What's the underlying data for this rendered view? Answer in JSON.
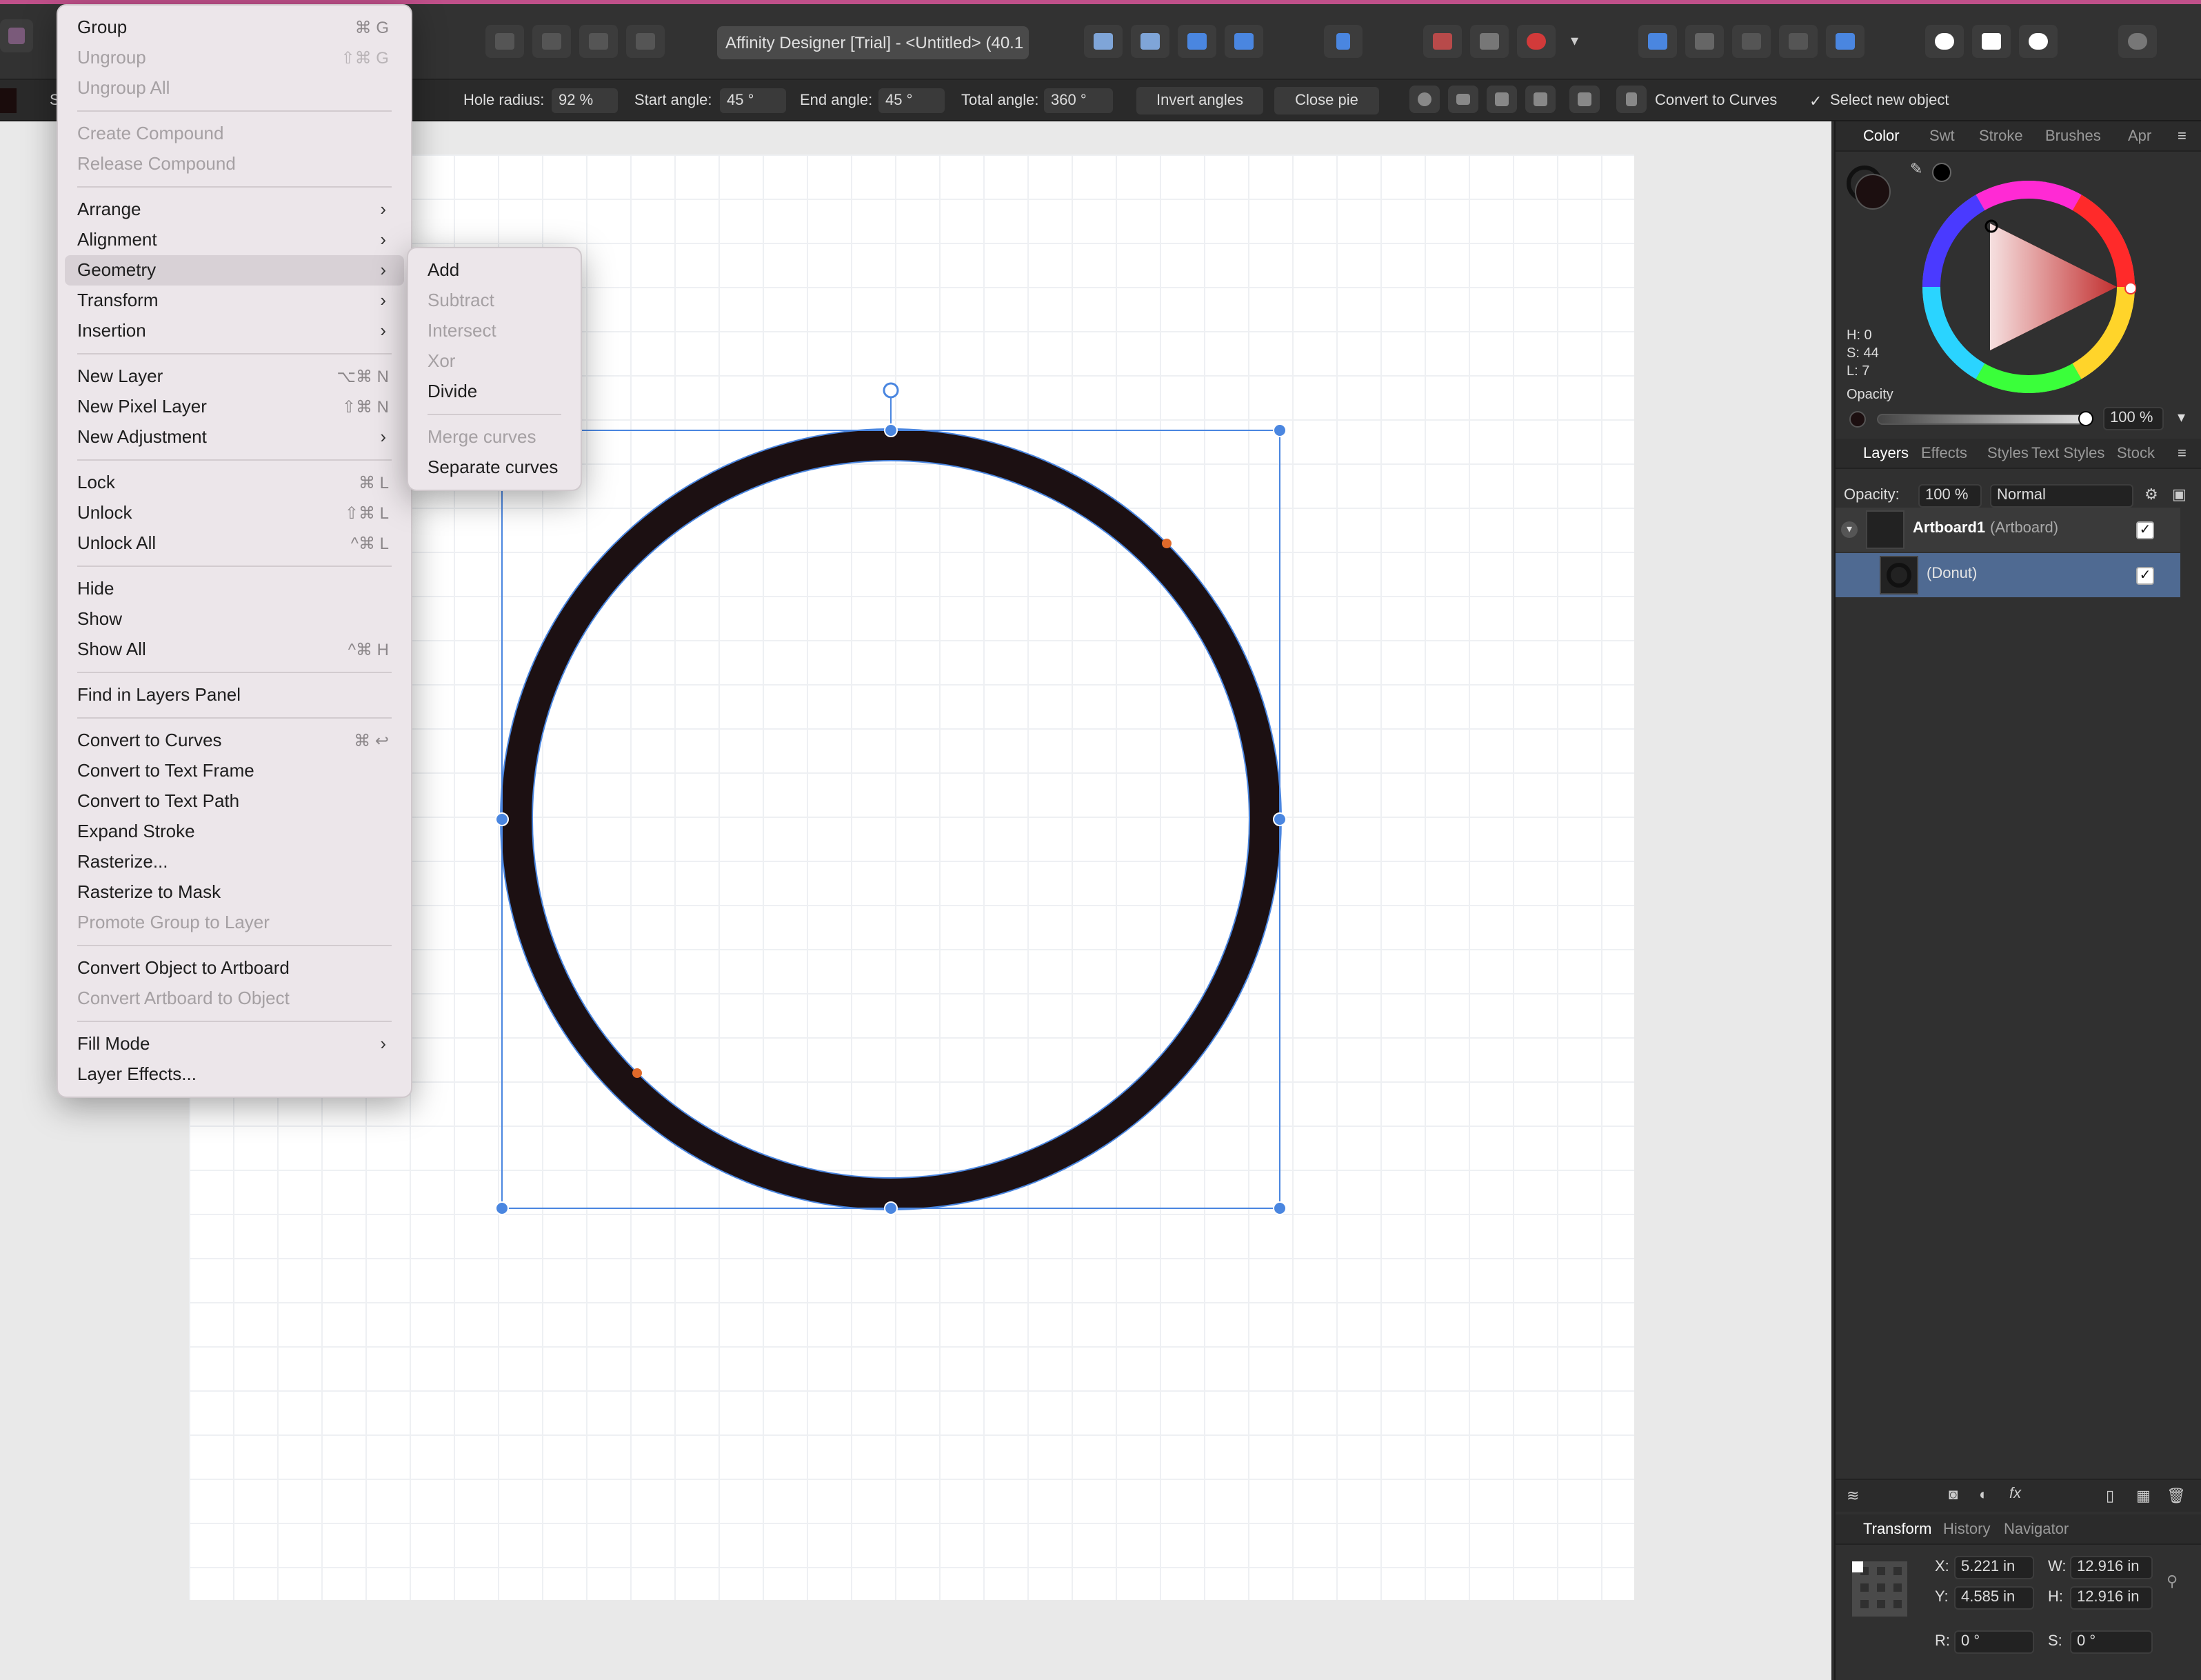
{
  "window": {
    "title": "Affinity Designer [Trial] - <Untitled> (40.1"
  },
  "context_toolbar": {
    "hole_radius_label": "Hole radius:",
    "hole_radius_value": "92 %",
    "start_angle_label": "Start angle:",
    "start_angle_value": "45 °",
    "end_angle_label": "End angle:",
    "end_angle_value": "45 °",
    "total_angle_label": "Total angle:",
    "total_angle_value": "360 °",
    "invert_angles": "Invert angles",
    "close_pie": "Close pie",
    "convert_to_curves": "Convert to Curves",
    "select_new_object": "Select new object",
    "truncated_left": "S"
  },
  "layer_menu": [
    {
      "label": "Group",
      "shortcut": "⌘ G",
      "disabled": false
    },
    {
      "label": "Ungroup",
      "shortcut": "⇧⌘ G",
      "disabled": true
    },
    {
      "label": "Ungroup All",
      "shortcut": "",
      "disabled": true
    },
    {
      "sep": true
    },
    {
      "label": "Create Compound",
      "shortcut": "",
      "disabled": true
    },
    {
      "label": "Release Compound",
      "shortcut": "",
      "disabled": true
    },
    {
      "sep": true
    },
    {
      "label": "Arrange",
      "submenu": true
    },
    {
      "label": "Alignment",
      "submenu": true
    },
    {
      "label": "Geometry",
      "submenu": true,
      "highlighted": true
    },
    {
      "label": "Transform",
      "submenu": true
    },
    {
      "label": "Insertion",
      "submenu": true
    },
    {
      "sep": true
    },
    {
      "label": "New Layer",
      "shortcut": "⌥⌘ N"
    },
    {
      "label": "New Pixel Layer",
      "shortcut": "⇧⌘ N"
    },
    {
      "label": "New Adjustment",
      "submenu": true
    },
    {
      "sep": true
    },
    {
      "label": "Lock",
      "shortcut": "⌘ L"
    },
    {
      "label": "Unlock",
      "shortcut": "⇧⌘ L"
    },
    {
      "label": "Unlock All",
      "shortcut": "^⌘ L"
    },
    {
      "sep": true
    },
    {
      "label": "Hide"
    },
    {
      "label": "Show"
    },
    {
      "label": "Show All",
      "shortcut": "^⌘ H"
    },
    {
      "sep": true
    },
    {
      "label": "Find in Layers Panel"
    },
    {
      "sep": true
    },
    {
      "label": "Convert to Curves",
      "shortcut": "⌘ ↩"
    },
    {
      "label": "Convert to Text Frame"
    },
    {
      "label": "Convert to Text Path"
    },
    {
      "label": "Expand Stroke"
    },
    {
      "label": "Rasterize..."
    },
    {
      "label": "Rasterize to Mask"
    },
    {
      "label": "Promote Group to Layer",
      "disabled": true
    },
    {
      "sep": true
    },
    {
      "label": "Convert Object to Artboard"
    },
    {
      "label": "Convert Artboard to Object",
      "disabled": true
    },
    {
      "sep": true
    },
    {
      "label": "Fill Mode",
      "submenu": true
    },
    {
      "label": "Layer Effects..."
    }
  ],
  "geometry_submenu": [
    {
      "label": "Add",
      "disabled": false
    },
    {
      "label": "Subtract",
      "disabled": true
    },
    {
      "label": "Intersect",
      "disabled": true
    },
    {
      "label": "Xor",
      "disabled": true
    },
    {
      "label": "Divide",
      "disabled": false
    },
    {
      "sep": true
    },
    {
      "label": "Merge curves",
      "disabled": true
    },
    {
      "label": "Separate curves",
      "disabled": false
    }
  ],
  "color_panel": {
    "tabs": [
      "Color",
      "Swt",
      "Stroke",
      "Brushes",
      "Apr"
    ],
    "h": "H: 0",
    "s": "S: 44",
    "l": "L: 7",
    "opacity_label": "Opacity",
    "opacity_value": "100 %"
  },
  "layers_panel": {
    "tabs": [
      "Layers",
      "Effects",
      "Styles",
      "Text Styles",
      "Stock"
    ],
    "opacity_label": "Opacity:",
    "opacity_value": "100 %",
    "blend_mode": "Normal",
    "artboard_name": "Artboard1",
    "artboard_type": "(Artboard)",
    "donut_name": "(Donut)"
  },
  "transform_panel": {
    "tabs": [
      "Transform",
      "History",
      "Navigator"
    ],
    "x_label": "X:",
    "x": "5.221 in",
    "y_label": "Y:",
    "y": "4.585 in",
    "w_label": "W:",
    "w": "12.916 in",
    "h_label": "H:",
    "h": "12.916 in",
    "r_label": "R:",
    "r": "0 °",
    "s_label": "S:",
    "s": "0 °"
  },
  "colors": {
    "accent": "#3b7be0",
    "donut": "#1c1012",
    "menu_bg": "#ece6ea"
  }
}
